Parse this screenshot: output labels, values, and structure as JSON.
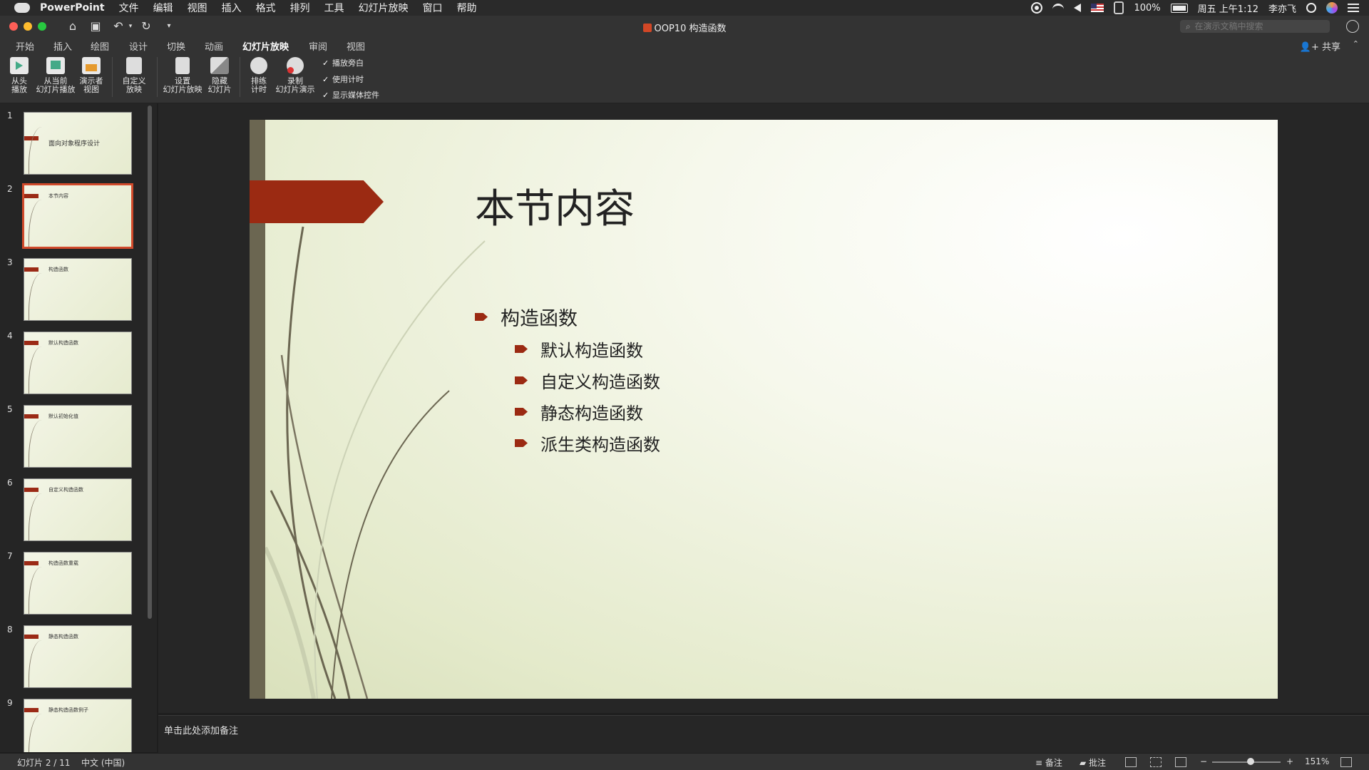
{
  "menubar": {
    "app_name": "PowerPoint",
    "items": [
      "文件",
      "编辑",
      "视图",
      "插入",
      "格式",
      "排列",
      "工具",
      "幻灯片放映",
      "窗口",
      "帮助"
    ],
    "battery": "100%",
    "clock": "周五 上午1:12",
    "user": "李亦飞"
  },
  "titlebar": {
    "doc_title": "OOP10 构造函数",
    "search_placeholder": "在演示文稿中搜索"
  },
  "tabs": [
    "开始",
    "插入",
    "绘图",
    "设计",
    "切换",
    "动画",
    "幻灯片放映",
    "审阅",
    "视图"
  ],
  "active_tab": "幻灯片放映",
  "share_label": "共享",
  "ribbon": {
    "from_start": [
      "从头",
      "播放"
    ],
    "from_current": [
      "从当前",
      "幻灯片播放"
    ],
    "presenter": [
      "演示者",
      "视图"
    ],
    "custom": [
      "自定义",
      "放映"
    ],
    "setup": [
      "设置",
      "幻灯片放映"
    ],
    "hide": [
      "隐藏",
      "幻灯片"
    ],
    "rehearse": [
      "排练",
      "计时"
    ],
    "record": [
      "录制",
      "幻灯片演示"
    ],
    "checks": [
      "播放旁白",
      "使用计时",
      "显示媒体控件"
    ]
  },
  "thumbnails": [
    {
      "num": "1",
      "title": "面向对象程序设计"
    },
    {
      "num": "2",
      "title": "本节内容"
    },
    {
      "num": "3",
      "title": "构造函数"
    },
    {
      "num": "4",
      "title": "默认构造函数"
    },
    {
      "num": "5",
      "title": "默认初始化值"
    },
    {
      "num": "6",
      "title": "自定义构造函数"
    },
    {
      "num": "7",
      "title": "构造函数重载"
    },
    {
      "num": "8",
      "title": "静态构造函数"
    },
    {
      "num": "9",
      "title": "静态构造函数例子"
    }
  ],
  "selected_thumbnail": "2",
  "slide": {
    "title": "本节内容",
    "bullet_l1": "构造函数",
    "bullets_l2": [
      "默认构造函数",
      "自定义构造函数",
      "静态构造函数",
      "派生类构造函数"
    ]
  },
  "notes_placeholder": "单击此处添加备注",
  "status": {
    "slide_count": "幻灯片 2 / 11",
    "language": "中文 (中国)",
    "notes_btn": "备注",
    "comments_btn": "批注",
    "zoom_minus": "−",
    "zoom_plus": "+",
    "zoom_level": "151%"
  },
  "colors": {
    "accent_red": "#9b2a12",
    "selection_border": "#d14a2b",
    "slide_bar": "#6b6651"
  }
}
